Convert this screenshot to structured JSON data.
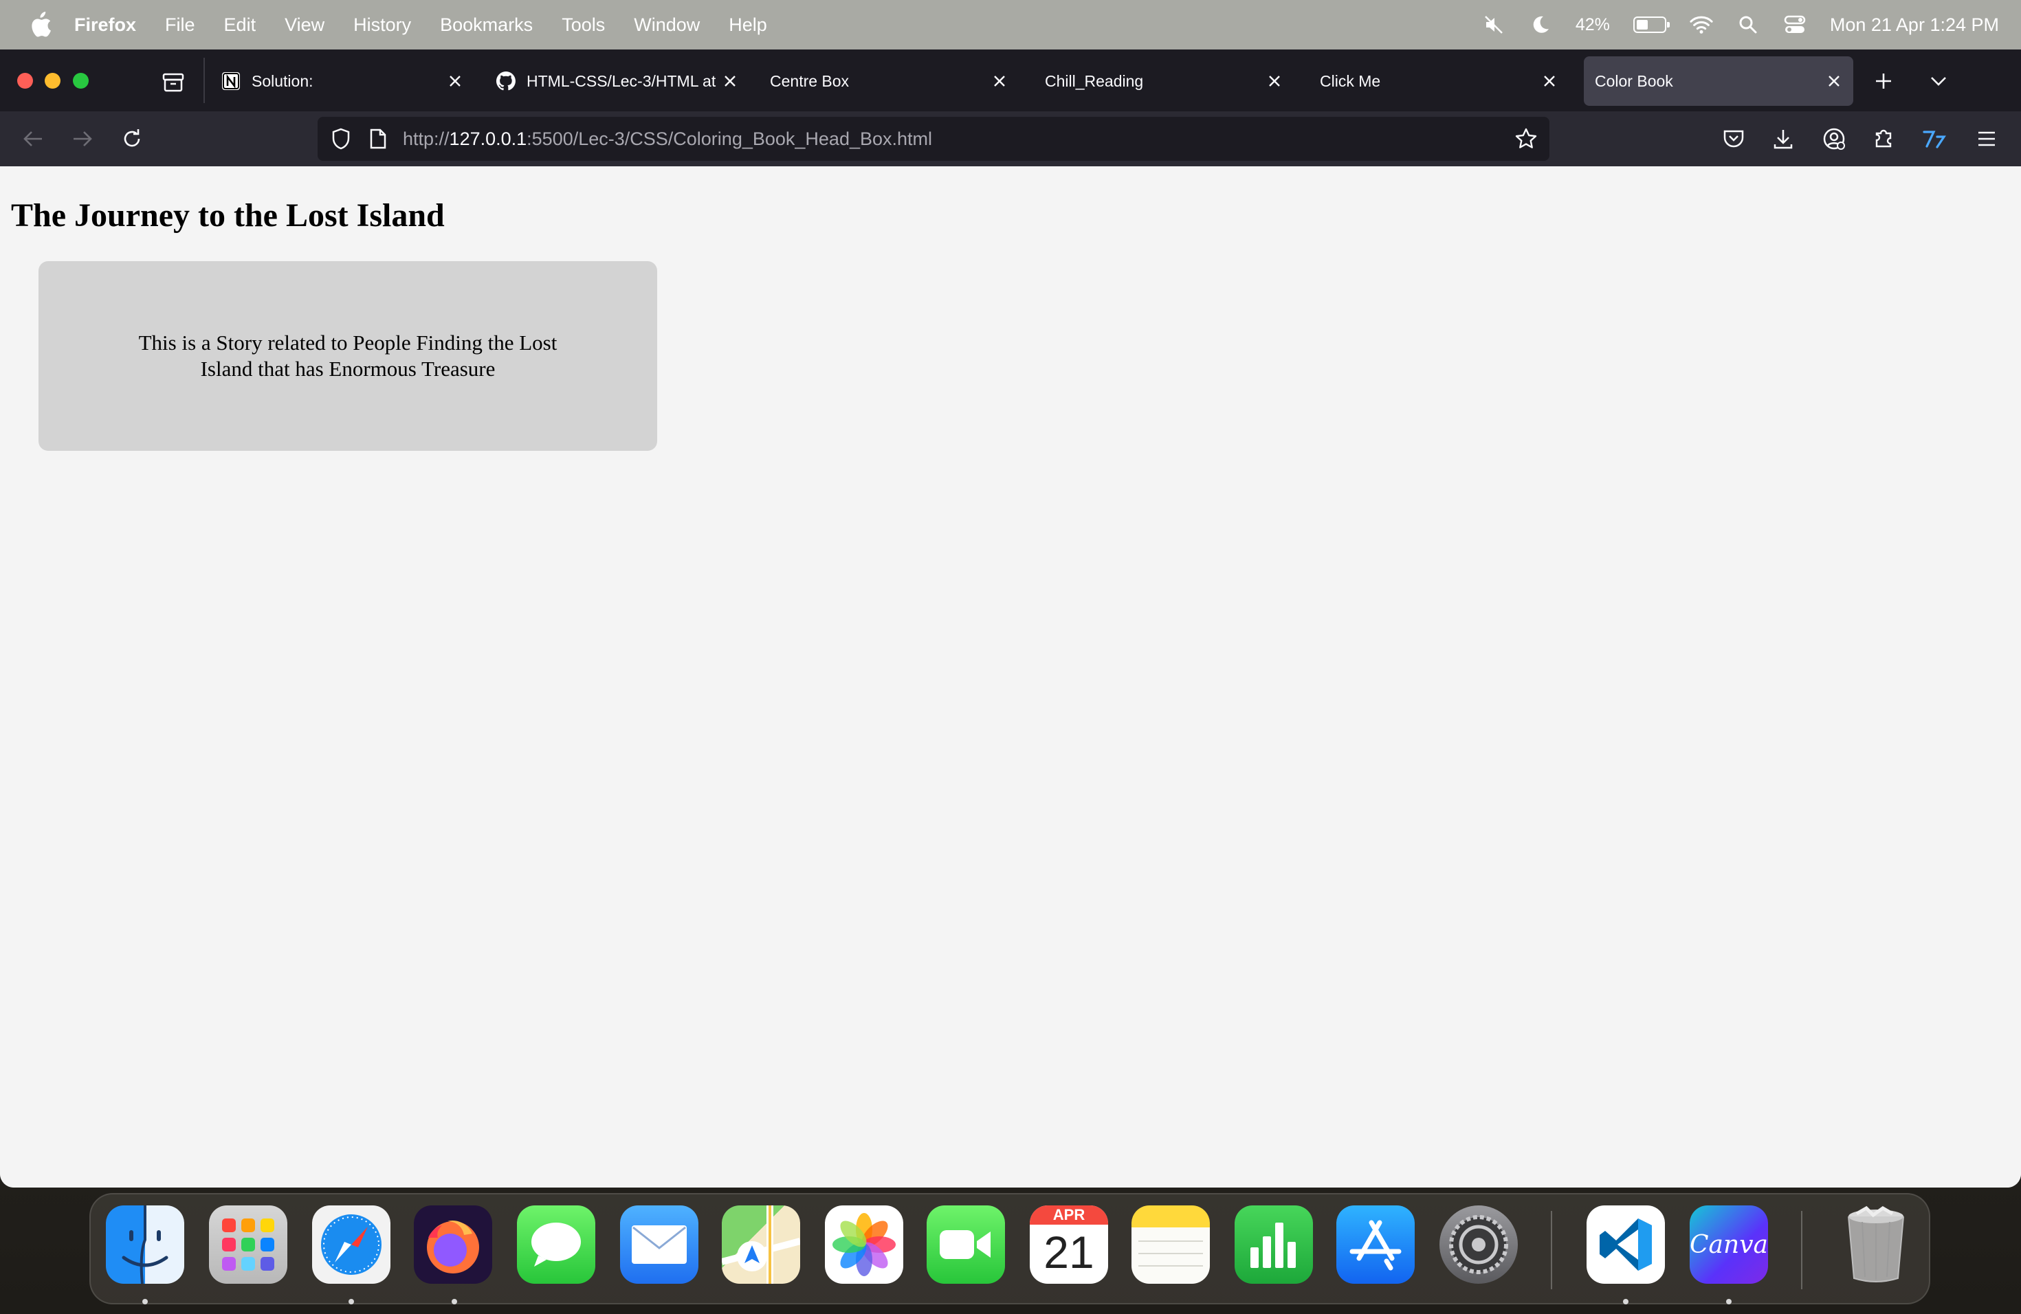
{
  "menubar": {
    "app_name": "Firefox",
    "items": [
      "File",
      "Edit",
      "View",
      "History",
      "Bookmarks",
      "Tools",
      "Window",
      "Help"
    ],
    "battery_percent": "42%",
    "datetime": "Mon 21 Apr  1:24 PM"
  },
  "tabs": [
    {
      "label": "Solution:",
      "icon": "notion-icon",
      "active": false
    },
    {
      "label": "HTML-CSS/Lec-3/HTML at",
      "icon": "github-icon",
      "active": false
    },
    {
      "label": "Centre Box",
      "icon": "",
      "active": false
    },
    {
      "label": "Chill_Reading",
      "icon": "",
      "active": false
    },
    {
      "label": "Click Me",
      "icon": "",
      "active": false
    },
    {
      "label": "Color Book",
      "icon": "",
      "active": true
    }
  ],
  "address_bar": {
    "url_scheme": "http://",
    "url_host": "127.0.0.1",
    "url_rest": ":5500/Lec-3/CSS/Coloring_Book_Head_Box.html"
  },
  "page": {
    "heading": "The Journey to the Lost Island",
    "story_text": "This is a Story related to People Finding the Lost Island that has Enormous Treasure"
  },
  "dock": {
    "calendar_month": "APR",
    "calendar_day": "21",
    "canva_label": "Canva",
    "apps": [
      "finder-icon",
      "launchpad-icon",
      "safari-icon",
      "firefox-icon",
      "messages-icon",
      "mail-icon",
      "maps-icon",
      "photos-icon",
      "facetime-icon",
      "calendar-icon",
      "notes-icon",
      "numbers-icon",
      "app-store-icon",
      "system-settings-icon",
      "vscode-icon",
      "canva-icon",
      "trash-icon"
    ]
  },
  "colors": {
    "tab_active_bg": "#42414d",
    "tabbar_bg": "#1c1b22",
    "navbar_bg": "#2b2a33",
    "story_box_bg": "#d3d3d3",
    "page_bg": "#f4f4f4"
  }
}
